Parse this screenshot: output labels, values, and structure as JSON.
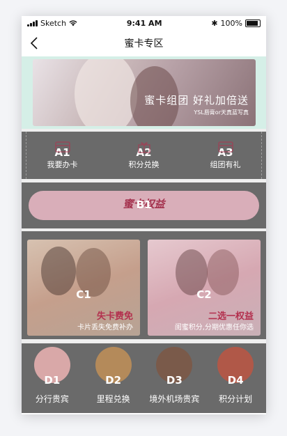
{
  "status": {
    "carrier": "Sketch",
    "time": "9:41 AM",
    "battery": "100%"
  },
  "nav": {
    "title": "蜜卡专区"
  },
  "banner": {
    "title": "蜜卡组团 好礼加倍送",
    "subtitle": "YSL唇膏or天真蓝写真"
  },
  "sectionA": {
    "items": [
      {
        "tag": "A1",
        "label": "我要办卡"
      },
      {
        "tag": "A2",
        "label": "积分兑换"
      },
      {
        "tag": "A3",
        "label": "组团有礼"
      }
    ]
  },
  "sectionB": {
    "tag": "B1",
    "logo": "蜜卡权益"
  },
  "sectionC": {
    "cards": [
      {
        "tag": "C1",
        "title": "失卡费免",
        "subtitle": "卡片丢失免费补办"
      },
      {
        "tag": "C2",
        "title": "二选一权益",
        "subtitle": "闺蜜积分,分期优惠任你选"
      }
    ]
  },
  "sectionD": {
    "items": [
      {
        "tag": "D1",
        "label": "分行贵宾",
        "color": "#d9a8a8"
      },
      {
        "tag": "D2",
        "label": "里程兑换",
        "color": "#b48a5a"
      },
      {
        "tag": "D3",
        "label": "境外机场贵宾",
        "color": "#7a5a4a"
      },
      {
        "tag": "D4",
        "label": "积分计划",
        "color": "#b05848"
      }
    ]
  },
  "colors": {
    "section_overlay": "#6a6a6a",
    "accent": "#b3304e",
    "banner_strip": "#d5efe7"
  }
}
